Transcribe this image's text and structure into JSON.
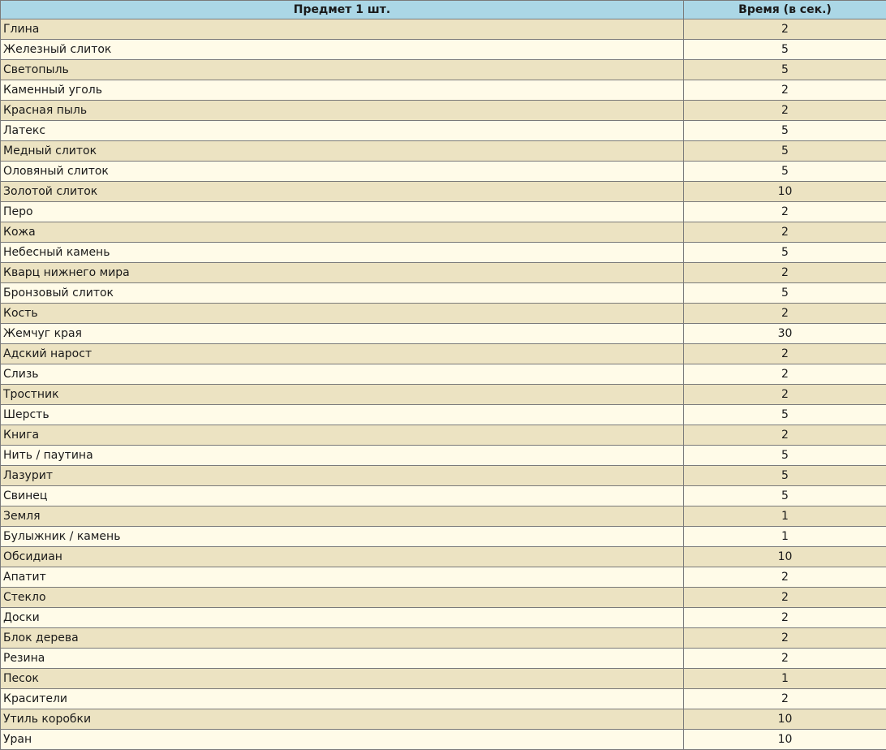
{
  "table": {
    "headers": [
      "Предмет 1 шт.",
      "Время (в сек.)"
    ],
    "rows": [
      [
        "Глина",
        "2"
      ],
      [
        "Железный слиток",
        "5"
      ],
      [
        "Светопыль",
        "5"
      ],
      [
        "Каменный уголь",
        "2"
      ],
      [
        "Красная пыль",
        "2"
      ],
      [
        "Латекс",
        "5"
      ],
      [
        "Медный слиток",
        "5"
      ],
      [
        "Оловяный слиток",
        "5"
      ],
      [
        "Золотой слиток",
        "10"
      ],
      [
        "Перо",
        "2"
      ],
      [
        "Кожа",
        "2"
      ],
      [
        "Небесный камень",
        "5"
      ],
      [
        "Кварц нижнего мира",
        "2"
      ],
      [
        "Бронзовый слиток",
        "5"
      ],
      [
        "Кость",
        "2"
      ],
      [
        "Жемчуг края",
        "30"
      ],
      [
        "Адский нарост",
        "2"
      ],
      [
        "Слизь",
        "2"
      ],
      [
        "Тростник",
        "2"
      ],
      [
        "Шерсть",
        "5"
      ],
      [
        "Книга",
        "2"
      ],
      [
        "Нить / паутина",
        "5"
      ],
      [
        "Лазурит",
        "5"
      ],
      [
        "Свинец",
        "5"
      ],
      [
        "Земля",
        "1"
      ],
      [
        "Булыжник / камень",
        "1"
      ],
      [
        "Обсидиан",
        "10"
      ],
      [
        "Апатит",
        "2"
      ],
      [
        "Стекло",
        "2"
      ],
      [
        "Доски",
        "2"
      ],
      [
        "Блок дерева",
        "2"
      ],
      [
        "Резина",
        "2"
      ],
      [
        "Песок",
        "1"
      ],
      [
        "Красители",
        "2"
      ],
      [
        "Утиль коробки",
        "10"
      ],
      [
        "Уран",
        "10"
      ]
    ]
  }
}
